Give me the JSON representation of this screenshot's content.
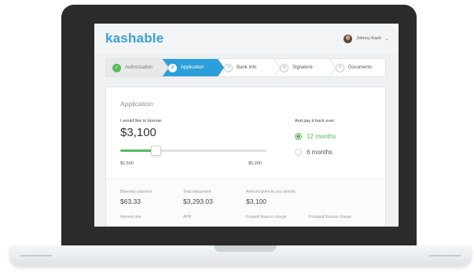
{
  "app": {
    "logo": "kashable"
  },
  "user": {
    "name": "Johnny Kash"
  },
  "steps": [
    {
      "number": "",
      "label": "Authorization",
      "state": "done"
    },
    {
      "number": "2",
      "label": "Application",
      "state": "active"
    },
    {
      "number": "3",
      "label": "Bank Info",
      "state": "pending"
    },
    {
      "number": "4",
      "label": "Signature",
      "state": "pending"
    },
    {
      "number": "5",
      "label": "Documents",
      "state": "pending"
    }
  ],
  "application": {
    "title": "Application",
    "borrow_label": "I would like to borrow:",
    "amount": "$3,100",
    "slider": {
      "min_label": "$2,500",
      "max_label": "$5,000",
      "min": 2500,
      "max": 5000,
      "value": 3100
    },
    "payback_label": "And pay it back over:",
    "options": [
      {
        "label": "12 months",
        "selected": true
      },
      {
        "label": "6 months",
        "selected": false
      }
    ]
  },
  "summary": {
    "row1": [
      {
        "label": "Biweekly payment",
        "value": "$63.33"
      },
      {
        "label": "Total repayment",
        "value": "$3,293.03"
      },
      {
        "label": "Amount given to you directly",
        "value": "$3,100"
      }
    ],
    "row2": [
      {
        "label": "Interest rate",
        "value": ""
      },
      {
        "label": "APR",
        "value": ""
      },
      {
        "label": "Prepaid finance charge",
        "value": ""
      },
      {
        "label": "Postpaid finance charge",
        "value": ""
      }
    ]
  },
  "colors": {
    "brand": "#3aa0d8",
    "active_step": "#2b9fd9",
    "success": "#5cb85c"
  },
  "icons": {
    "done_step": "check-icon",
    "user_menu": "chevron-down-icon"
  }
}
